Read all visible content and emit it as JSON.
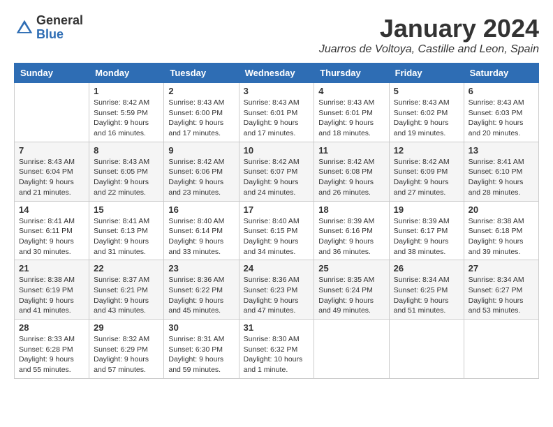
{
  "header": {
    "logo_general": "General",
    "logo_blue": "Blue",
    "month_title": "January 2024",
    "location": "Juarros de Voltoya, Castille and Leon, Spain"
  },
  "weekdays": [
    "Sunday",
    "Monday",
    "Tuesday",
    "Wednesday",
    "Thursday",
    "Friday",
    "Saturday"
  ],
  "weeks": [
    [
      {
        "day": "",
        "info": ""
      },
      {
        "day": "1",
        "info": "Sunrise: 8:42 AM\nSunset: 5:59 PM\nDaylight: 9 hours\nand 16 minutes."
      },
      {
        "day": "2",
        "info": "Sunrise: 8:43 AM\nSunset: 6:00 PM\nDaylight: 9 hours\nand 17 minutes."
      },
      {
        "day": "3",
        "info": "Sunrise: 8:43 AM\nSunset: 6:01 PM\nDaylight: 9 hours\nand 17 minutes."
      },
      {
        "day": "4",
        "info": "Sunrise: 8:43 AM\nSunset: 6:01 PM\nDaylight: 9 hours\nand 18 minutes."
      },
      {
        "day": "5",
        "info": "Sunrise: 8:43 AM\nSunset: 6:02 PM\nDaylight: 9 hours\nand 19 minutes."
      },
      {
        "day": "6",
        "info": "Sunrise: 8:43 AM\nSunset: 6:03 PM\nDaylight: 9 hours\nand 20 minutes."
      }
    ],
    [
      {
        "day": "7",
        "info": "Sunrise: 8:43 AM\nSunset: 6:04 PM\nDaylight: 9 hours\nand 21 minutes."
      },
      {
        "day": "8",
        "info": "Sunrise: 8:43 AM\nSunset: 6:05 PM\nDaylight: 9 hours\nand 22 minutes."
      },
      {
        "day": "9",
        "info": "Sunrise: 8:42 AM\nSunset: 6:06 PM\nDaylight: 9 hours\nand 23 minutes."
      },
      {
        "day": "10",
        "info": "Sunrise: 8:42 AM\nSunset: 6:07 PM\nDaylight: 9 hours\nand 24 minutes."
      },
      {
        "day": "11",
        "info": "Sunrise: 8:42 AM\nSunset: 6:08 PM\nDaylight: 9 hours\nand 26 minutes."
      },
      {
        "day": "12",
        "info": "Sunrise: 8:42 AM\nSunset: 6:09 PM\nDaylight: 9 hours\nand 27 minutes."
      },
      {
        "day": "13",
        "info": "Sunrise: 8:41 AM\nSunset: 6:10 PM\nDaylight: 9 hours\nand 28 minutes."
      }
    ],
    [
      {
        "day": "14",
        "info": "Sunrise: 8:41 AM\nSunset: 6:11 PM\nDaylight: 9 hours\nand 30 minutes."
      },
      {
        "day": "15",
        "info": "Sunrise: 8:41 AM\nSunset: 6:13 PM\nDaylight: 9 hours\nand 31 minutes."
      },
      {
        "day": "16",
        "info": "Sunrise: 8:40 AM\nSunset: 6:14 PM\nDaylight: 9 hours\nand 33 minutes."
      },
      {
        "day": "17",
        "info": "Sunrise: 8:40 AM\nSunset: 6:15 PM\nDaylight: 9 hours\nand 34 minutes."
      },
      {
        "day": "18",
        "info": "Sunrise: 8:39 AM\nSunset: 6:16 PM\nDaylight: 9 hours\nand 36 minutes."
      },
      {
        "day": "19",
        "info": "Sunrise: 8:39 AM\nSunset: 6:17 PM\nDaylight: 9 hours\nand 38 minutes."
      },
      {
        "day": "20",
        "info": "Sunrise: 8:38 AM\nSunset: 6:18 PM\nDaylight: 9 hours\nand 39 minutes."
      }
    ],
    [
      {
        "day": "21",
        "info": "Sunrise: 8:38 AM\nSunset: 6:19 PM\nDaylight: 9 hours\nand 41 minutes."
      },
      {
        "day": "22",
        "info": "Sunrise: 8:37 AM\nSunset: 6:21 PM\nDaylight: 9 hours\nand 43 minutes."
      },
      {
        "day": "23",
        "info": "Sunrise: 8:36 AM\nSunset: 6:22 PM\nDaylight: 9 hours\nand 45 minutes."
      },
      {
        "day": "24",
        "info": "Sunrise: 8:36 AM\nSunset: 6:23 PM\nDaylight: 9 hours\nand 47 minutes."
      },
      {
        "day": "25",
        "info": "Sunrise: 8:35 AM\nSunset: 6:24 PM\nDaylight: 9 hours\nand 49 minutes."
      },
      {
        "day": "26",
        "info": "Sunrise: 8:34 AM\nSunset: 6:25 PM\nDaylight: 9 hours\nand 51 minutes."
      },
      {
        "day": "27",
        "info": "Sunrise: 8:34 AM\nSunset: 6:27 PM\nDaylight: 9 hours\nand 53 minutes."
      }
    ],
    [
      {
        "day": "28",
        "info": "Sunrise: 8:33 AM\nSunset: 6:28 PM\nDaylight: 9 hours\nand 55 minutes."
      },
      {
        "day": "29",
        "info": "Sunrise: 8:32 AM\nSunset: 6:29 PM\nDaylight: 9 hours\nand 57 minutes."
      },
      {
        "day": "30",
        "info": "Sunrise: 8:31 AM\nSunset: 6:30 PM\nDaylight: 9 hours\nand 59 minutes."
      },
      {
        "day": "31",
        "info": "Sunrise: 8:30 AM\nSunset: 6:32 PM\nDaylight: 10 hours\nand 1 minute."
      },
      {
        "day": "",
        "info": ""
      },
      {
        "day": "",
        "info": ""
      },
      {
        "day": "",
        "info": ""
      }
    ]
  ]
}
